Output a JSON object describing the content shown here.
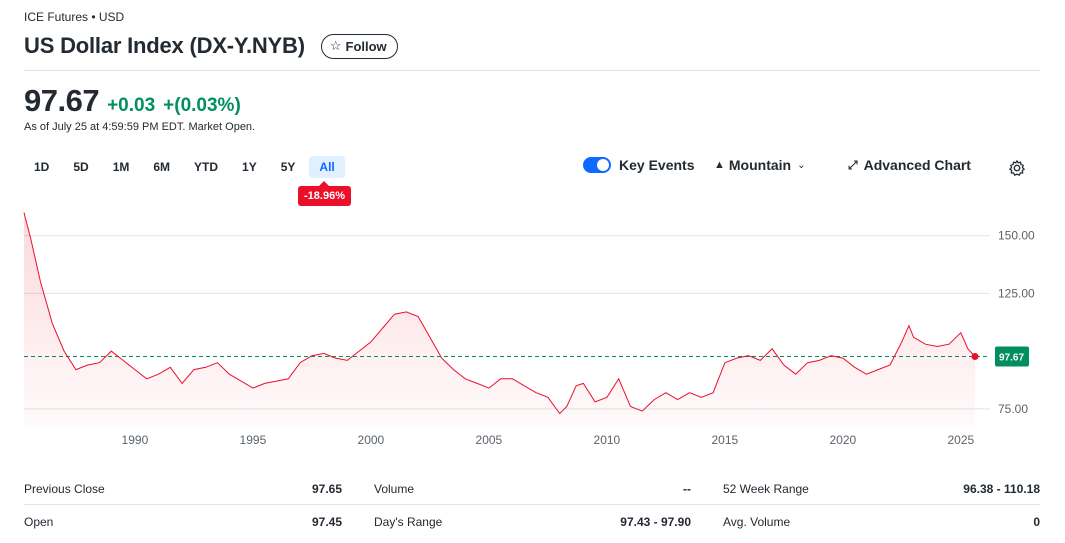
{
  "header": {
    "breadcrumb": "ICE Futures • USD",
    "title": "US Dollar Index (DX-Y.NYB)",
    "follow_label": "Follow"
  },
  "quote": {
    "price": "97.67",
    "change": "+0.03",
    "change_pct": "+(0.03%)",
    "as_of": "As of July 25 at 4:59:59 PM EDT. Market Open.",
    "up_color": "#008f5d"
  },
  "toolbar": {
    "ranges": [
      "1D",
      "5D",
      "1M",
      "6M",
      "YTD",
      "1Y",
      "5Y",
      "All"
    ],
    "active_range": "All",
    "performance": "-18.96%",
    "key_events_label": "Key Events",
    "chart_type_label": "Mountain",
    "advanced_label": "Advanced Chart"
  },
  "chart_data": {
    "type": "area",
    "x_ticks": [
      "1990",
      "1995",
      "2000",
      "2005",
      "2010",
      "2015",
      "2020",
      "2025"
    ],
    "y_ticks": [
      "150.00",
      "125.00",
      "75.00"
    ],
    "ylim": [
      68,
      162
    ],
    "xlim": [
      1985.3,
      2025.6
    ],
    "reference_line": 97.65,
    "current_label": "97.67",
    "line_color": "#eb0f29",
    "marker_color": "#008f5d",
    "x": [
      1985.3,
      1985.6,
      1986.0,
      1986.5,
      1987.0,
      1987.5,
      1988.0,
      1988.5,
      1989.0,
      1989.5,
      1990.0,
      1990.5,
      1991.0,
      1991.5,
      1992.0,
      1992.5,
      1993.0,
      1993.5,
      1994.0,
      1994.5,
      1995.0,
      1995.5,
      1996.0,
      1996.5,
      1997.0,
      1997.5,
      1998.0,
      1998.5,
      1999.0,
      1999.5,
      2000.0,
      2000.5,
      2001.0,
      2001.5,
      2002.0,
      2002.5,
      2003.0,
      2003.5,
      2004.0,
      2004.5,
      2005.0,
      2005.5,
      2006.0,
      2006.5,
      2007.0,
      2007.5,
      2008.0,
      2008.3,
      2008.7,
      2009.0,
      2009.5,
      2010.0,
      2010.5,
      2011.0,
      2011.5,
      2012.0,
      2012.5,
      2013.0,
      2013.5,
      2014.0,
      2014.5,
      2015.0,
      2015.5,
      2016.0,
      2016.5,
      2017.0,
      2017.5,
      2018.0,
      2018.5,
      2019.0,
      2019.5,
      2020.0,
      2020.5,
      2021.0,
      2021.5,
      2022.0,
      2022.5,
      2022.8,
      2023.0,
      2023.5,
      2024.0,
      2024.5,
      2025.0,
      2025.3,
      2025.6
    ],
    "y": [
      160,
      148,
      130,
      112,
      100,
      92,
      94,
      95,
      100,
      96,
      92,
      88,
      90,
      93,
      86,
      92,
      93,
      95,
      90,
      87,
      84,
      86,
      87,
      88,
      95,
      98,
      99,
      97,
      96,
      100,
      104,
      110,
      116,
      117,
      115,
      106,
      97,
      92,
      88,
      86,
      84,
      88,
      88,
      85,
      82,
      80,
      73,
      76,
      85,
      86,
      78,
      80,
      88,
      76,
      74,
      79,
      82,
      79,
      82,
      80,
      82,
      95,
      97,
      98,
      96,
      101,
      94,
      90,
      95,
      96,
      98,
      97,
      93,
      90,
      92,
      94,
      104,
      111,
      106,
      103,
      102,
      103,
      108,
      101,
      97.67
    ]
  },
  "stats": {
    "rows": [
      [
        {
          "label": "Previous Close",
          "value": "97.65"
        },
        {
          "label": "Volume",
          "value": "--"
        },
        {
          "label": "52 Week Range",
          "value": "96.38 - 110.18"
        }
      ],
      [
        {
          "label": "Open",
          "value": "97.45"
        },
        {
          "label": "Day's Range",
          "value": "97.43 - 97.90"
        },
        {
          "label": "Avg. Volume",
          "value": "0"
        }
      ]
    ]
  }
}
